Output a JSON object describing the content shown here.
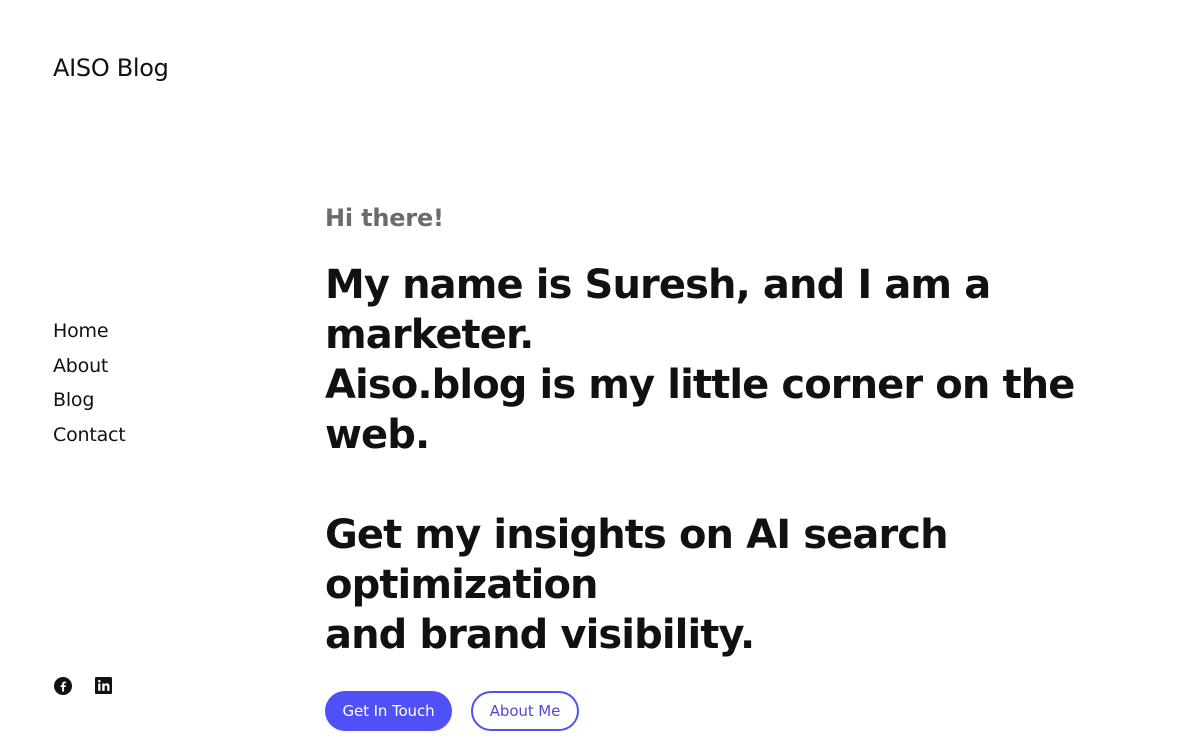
{
  "site": {
    "title": "AISO Blog"
  },
  "nav": {
    "items": [
      {
        "label": "Home"
      },
      {
        "label": "About"
      },
      {
        "label": "Blog"
      },
      {
        "label": "Contact"
      }
    ]
  },
  "hero": {
    "greeting": "Hi there!",
    "intro_line_1": "My name is Suresh, and I am a marketer.",
    "intro_line_2": "Aiso.blog is my little corner on the web.",
    "pitch_line_1": "Get my insights on AI search optimization",
    "pitch_line_2": "and brand visibility.",
    "primary_button": "Get In Touch",
    "secondary_button": "About Me"
  },
  "social": {
    "icons": [
      "facebook-icon",
      "linkedin-icon"
    ]
  },
  "colors": {
    "accent": "#5050f7",
    "text": "#111111",
    "muted": "#6b6b6b",
    "background": "#ffffff"
  }
}
